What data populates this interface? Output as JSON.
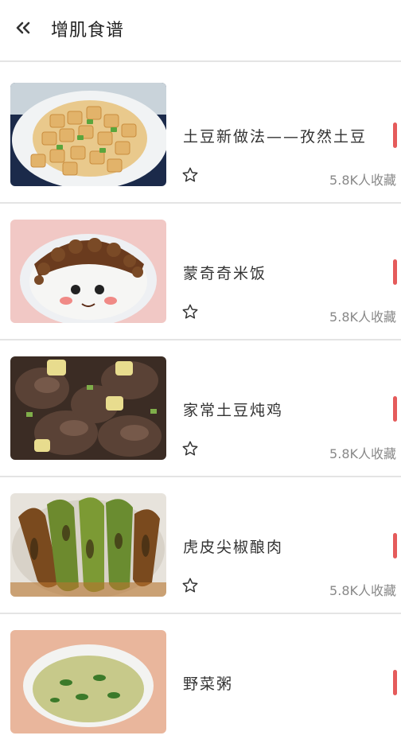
{
  "header": {
    "back_icon": "double-chevron-left-icon",
    "title": "增肌食谱"
  },
  "colors": {
    "accent_bar": "#e55b5b",
    "divider": "#e4e4e4"
  },
  "recipes": [
    {
      "name": "土豆新做法——孜然土豆",
      "favorites": "5.8K人收藏",
      "star_icon": "star-outline-icon"
    },
    {
      "name": "蒙奇奇米饭",
      "favorites": "5.8K人收藏",
      "star_icon": "star-outline-icon"
    },
    {
      "name": "家常土豆炖鸡",
      "favorites": "5.8K人收藏",
      "star_icon": "star-outline-icon"
    },
    {
      "name": "虎皮尖椒酿肉",
      "favorites": "5.8K人收藏",
      "star_icon": "star-outline-icon"
    },
    {
      "name": "野菜粥",
      "favorites": "",
      "star_icon": "star-outline-icon"
    }
  ]
}
